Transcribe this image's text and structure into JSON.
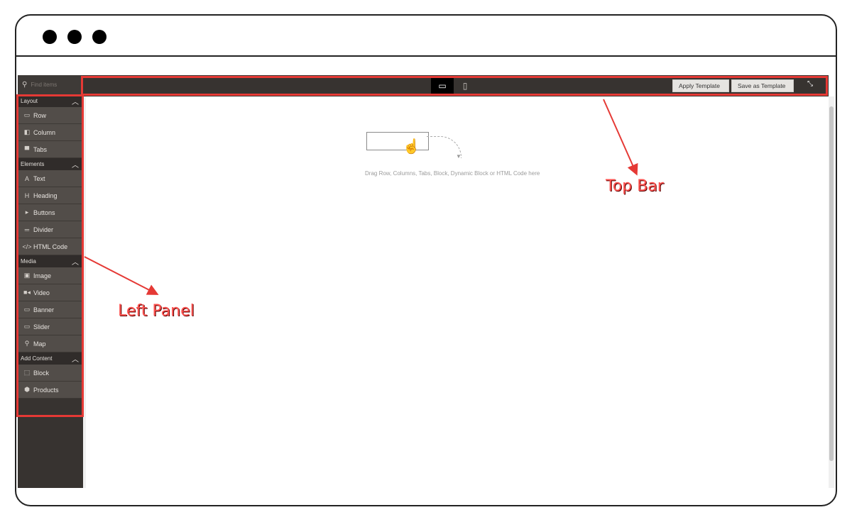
{
  "sidebar": {
    "search_placeholder": "Find items",
    "groups": [
      {
        "label": "Layout",
        "items": [
          {
            "label": "Row",
            "icon": "row-icon",
            "glyph": "▭"
          },
          {
            "label": "Column",
            "icon": "column-icon",
            "glyph": "◧"
          },
          {
            "label": "Tabs",
            "icon": "tabs-icon",
            "glyph": "▀"
          }
        ]
      },
      {
        "label": "Elements",
        "items": [
          {
            "label": "Text",
            "icon": "text-icon",
            "glyph": "A"
          },
          {
            "label": "Heading",
            "icon": "heading-icon",
            "glyph": "H"
          },
          {
            "label": "Buttons",
            "icon": "cursor-icon",
            "glyph": "▸"
          },
          {
            "label": "Divider",
            "icon": "divider-icon",
            "glyph": "═"
          },
          {
            "label": "HTML Code",
            "icon": "code-icon",
            "glyph": "</>"
          }
        ]
      },
      {
        "label": "Media",
        "items": [
          {
            "label": "Image",
            "icon": "image-icon",
            "glyph": "▣"
          },
          {
            "label": "Video",
            "icon": "video-icon",
            "glyph": "■◂"
          },
          {
            "label": "Banner",
            "icon": "banner-icon",
            "glyph": "▭"
          },
          {
            "label": "Slider",
            "icon": "slider-icon",
            "glyph": "▭"
          },
          {
            "label": "Map",
            "icon": "map-pin-icon",
            "glyph": "⚲"
          }
        ]
      },
      {
        "label": "Add Content",
        "items": [
          {
            "label": "Block",
            "icon": "block-icon",
            "glyph": "⬚"
          },
          {
            "label": "Products",
            "icon": "products-icon",
            "glyph": "⬢"
          }
        ]
      }
    ]
  },
  "topbar": {
    "apply_template": "Apply Template",
    "save_template": "Save as Template",
    "view_desktop_icon": "desktop-view-icon",
    "view_mobile_icon": "mobile-view-icon",
    "fullscreen_icon": "collapse-icon"
  },
  "stage": {
    "drop_text": "Drag Row, Columns, Tabs, Block, Dynamic Block or HTML Code here"
  },
  "annotations": {
    "top_bar": "Top Bar",
    "left_panel": "Left Panel",
    "color": "#e53935"
  }
}
